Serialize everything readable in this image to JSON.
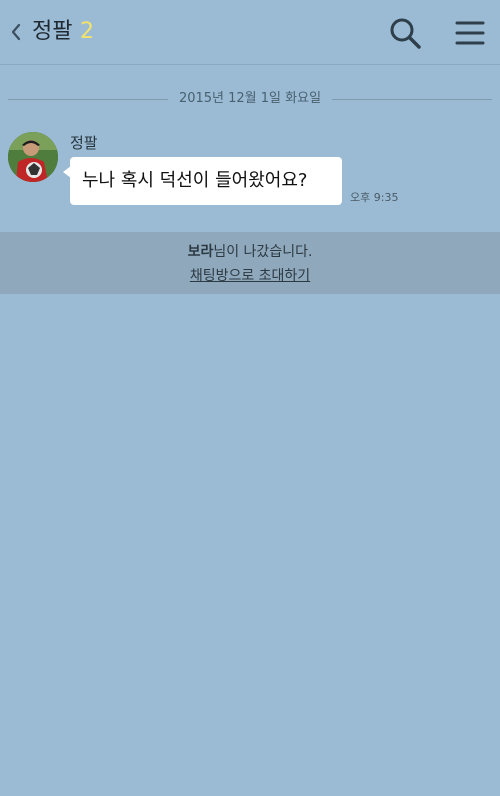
{
  "header": {
    "title": "정팔",
    "member_count": "2",
    "back_icon": "chevron-left-icon",
    "search_icon": "search-icon",
    "menu_icon": "menu-icon"
  },
  "chat": {
    "date_separator": "2015년 12월 1일 화요일",
    "messages": [
      {
        "sender": "정팔",
        "text": "누나 혹시 덕선이 들어왔어요?",
        "time": "오후 9:35"
      }
    ],
    "notice": {
      "name": "보라",
      "text": "님이 나갔습니다.",
      "invite_link": "채팅방으로 초대하기"
    }
  },
  "colors": {
    "background": "#9bbbd4",
    "member_count": "#f3e36a",
    "bubble": "#ffffff",
    "notice_background": "#8fa8bb"
  }
}
